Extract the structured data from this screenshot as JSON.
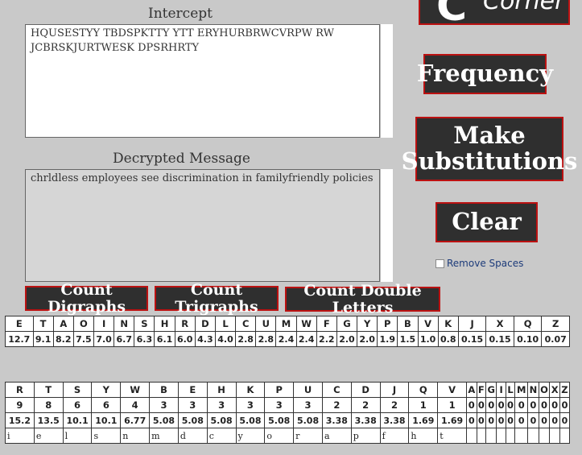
{
  "logo": {
    "letter": "C",
    "text": "Corner"
  },
  "intercept": {
    "label": "Intercept",
    "text": " HQUSESTYY  TBDSPKTTY YTT ERYHURBRWCVRPW RW JCBRSKJURTWESK DPSRHRTY"
  },
  "decrypted": {
    "label": "Decrypted Message",
    "text": " chrldless  employees see discrimination in familyfriendly policies"
  },
  "buttons": {
    "frequency": "Frequency",
    "make_substitutions": "Make Substitutions",
    "clear": "Clear",
    "count_digraphs": "Count Digraphs",
    "count_trigraphs": "Count Trigraphs",
    "count_double_letters": "Count Double Letters"
  },
  "remove_spaces": {
    "label": "Remove Spaces",
    "checked": false
  },
  "english_freq": {
    "letters": [
      "E",
      "T",
      "A",
      "O",
      "I",
      "N",
      "S",
      "H",
      "R",
      "D",
      "L",
      "C",
      "U",
      "M",
      "W",
      "F",
      "G",
      "Y",
      "P",
      "B",
      "V",
      "K",
      "J",
      "X",
      "Q",
      "Z"
    ],
    "percents": [
      "12.7",
      "9.1",
      "8.2",
      "7.5",
      "7.0",
      "6.7",
      "6.3",
      "6.1",
      "6.0",
      "4.3",
      "4.0",
      "2.8",
      "2.8",
      "2.4",
      "2.4",
      "2.2",
      "2.0",
      "2.0",
      "1.9",
      "1.5",
      "1.0",
      "0.8",
      "0.15",
      "0.15",
      "0.10",
      "0.07"
    ]
  },
  "cipher_freq": {
    "letters": [
      "R",
      "T",
      "S",
      "Y",
      "W",
      "B",
      "E",
      "H",
      "K",
      "P",
      "U",
      "C",
      "D",
      "J",
      "Q",
      "V",
      "A",
      "F",
      "G",
      "I",
      "L",
      "M",
      "N",
      "O",
      "X",
      "Z"
    ],
    "counts": [
      "9",
      "8",
      "6",
      "6",
      "4",
      "3",
      "3",
      "3",
      "3",
      "3",
      "3",
      "2",
      "2",
      "2",
      "1",
      "1",
      "0",
      "0",
      "0",
      "0",
      "0",
      "0",
      "0",
      "0",
      "0",
      "0"
    ],
    "percents": [
      "15.2",
      "13.5",
      "10.1",
      "10.1",
      "6.77",
      "5.08",
      "5.08",
      "5.08",
      "5.08",
      "5.08",
      "5.08",
      "3.38",
      "3.38",
      "3.38",
      "1.69",
      "1.69",
      "0",
      "0",
      "0",
      "0",
      "0",
      "0",
      "0",
      "0",
      "0",
      "0"
    ],
    "substitutions": [
      "i",
      "e",
      "l",
      "s",
      "n",
      "m",
      "d",
      "c",
      "y",
      "o",
      "r",
      "a",
      "p",
      "f",
      "h",
      "t",
      "",
      "",
      "",
      "",
      "",
      "",
      "",
      "",
      "",
      ""
    ]
  }
}
